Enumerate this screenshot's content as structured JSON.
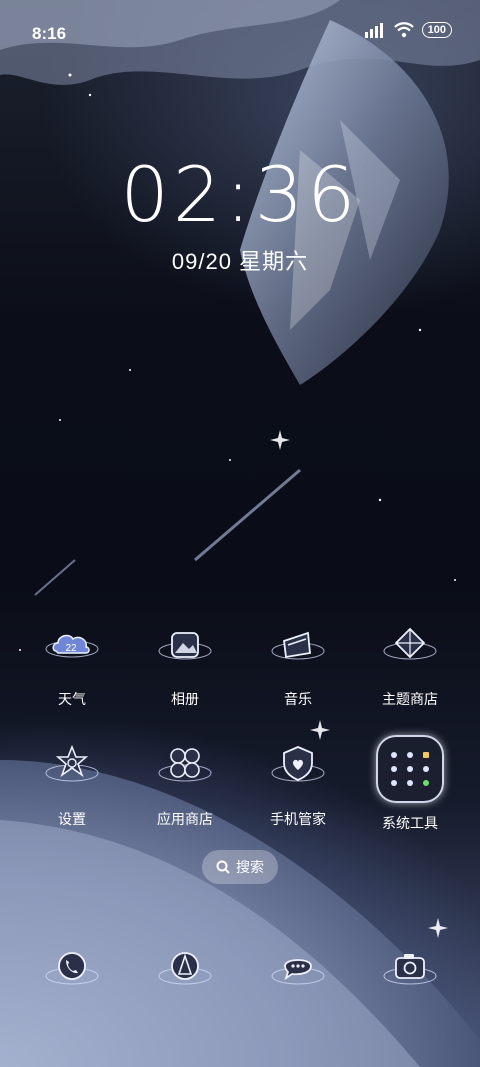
{
  "status_bar": {
    "time": "8:16",
    "battery": "100"
  },
  "lockclock": {
    "time": "02:36",
    "date": "09/20 星期六"
  },
  "weather_temp": "22",
  "apps_row1": [
    {
      "label": "天气"
    },
    {
      "label": "相册"
    },
    {
      "label": "音乐"
    },
    {
      "label": "主题商店"
    }
  ],
  "apps_row2": [
    {
      "label": "设置"
    },
    {
      "label": "应用商店"
    },
    {
      "label": "手机管家"
    },
    {
      "label": "系统工具"
    }
  ],
  "search": {
    "label": "搜索"
  },
  "dock": [
    {
      "icon": "phone-icon"
    },
    {
      "icon": "browser-icon"
    },
    {
      "icon": "messages-icon"
    },
    {
      "icon": "camera-icon"
    }
  ]
}
